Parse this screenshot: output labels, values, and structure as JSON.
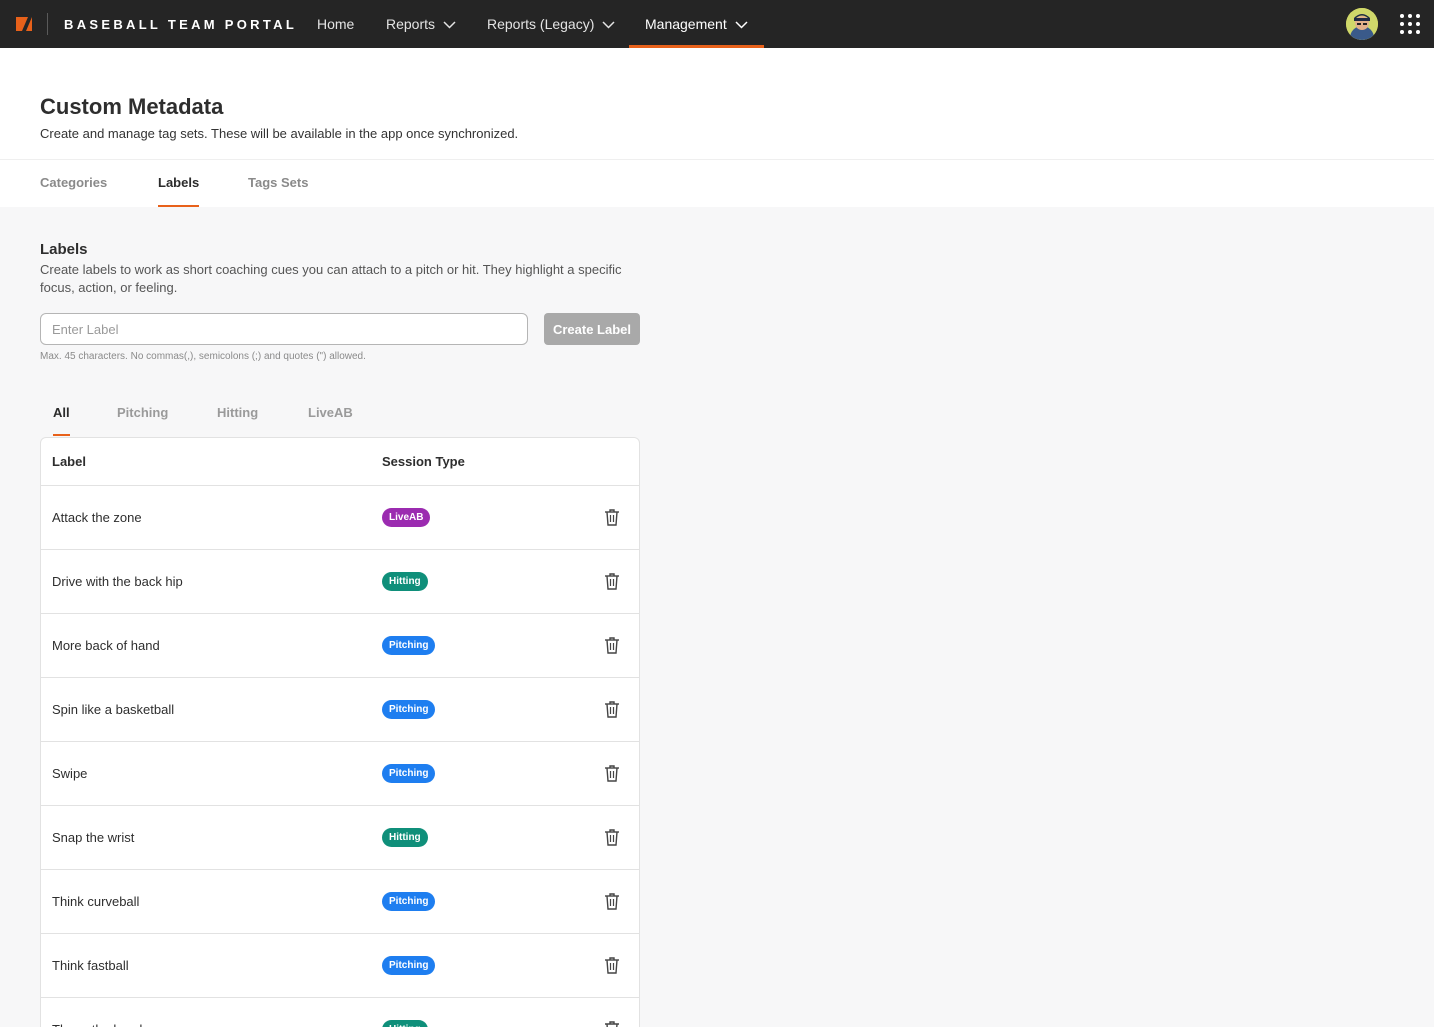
{
  "brand": "BASEBALL TEAM PORTAL",
  "nav": {
    "home": "Home",
    "reports": "Reports",
    "reports_legacy": "Reports (Legacy)",
    "management": "Management"
  },
  "page": {
    "title": "Custom Metadata",
    "subtitle": "Create and manage tag sets. These will be available in the app once synchronized."
  },
  "tabs": {
    "categories": "Categories",
    "labels": "Labels",
    "tag_sets": "Tags Sets"
  },
  "labels_section": {
    "title": "Labels",
    "description": "Create labels to work as short coaching cues you can attach to a pitch or hit. They highlight a specific focus, action, or feeling.",
    "input_placeholder": "Enter Label",
    "create_button": "Create Label",
    "hint": "Max. 45 characters. No commas(,), semicolons (;) and quotes (\") allowed."
  },
  "filters": {
    "all": "All",
    "pitching": "Pitching",
    "hitting": "Hitting",
    "liveab": "LiveAB"
  },
  "table": {
    "col_label": "Label",
    "col_session": "Session Type",
    "rows": [
      {
        "label": "Attack the zone",
        "session": "LiveAB"
      },
      {
        "label": "Drive with the back hip",
        "session": "Hitting"
      },
      {
        "label": "More back of hand",
        "session": "Pitching"
      },
      {
        "label": "Spin like a basketball",
        "session": "Pitching"
      },
      {
        "label": "Swipe",
        "session": "Pitching"
      },
      {
        "label": "Snap the wrist",
        "session": "Hitting"
      },
      {
        "label": "Think curveball",
        "session": "Pitching"
      },
      {
        "label": "Think fastball",
        "session": "Pitching"
      },
      {
        "label": "Throw the hands",
        "session": "Hitting"
      }
    ]
  },
  "colors": {
    "accent": "#e8611a",
    "topbar": "#252525",
    "badge_liveab": "#9b2bb0",
    "badge_hitting": "#0f8f7a",
    "badge_pitching": "#1e7ef0"
  },
  "icons": {
    "logo": "brand-logo-icon",
    "chevron": "chevron-down-icon",
    "apps": "grid-apps-icon",
    "delete": "trash-icon"
  }
}
